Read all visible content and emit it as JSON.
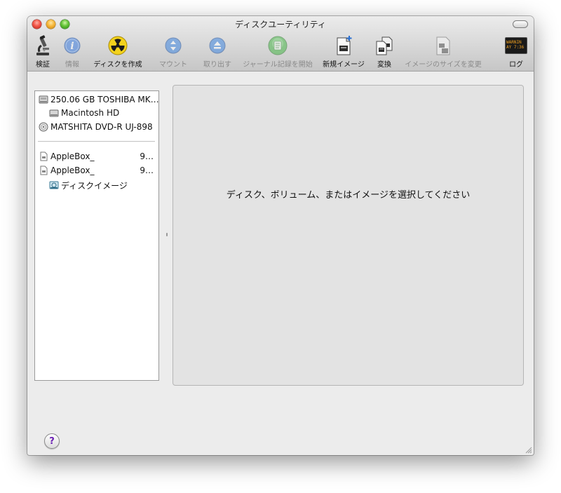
{
  "window": {
    "title": "ディスクユーティリティ"
  },
  "toolbar": {
    "items": [
      {
        "label": "検証",
        "icon": "microscope-icon",
        "enabled": true
      },
      {
        "label": "情報",
        "icon": "info-icon",
        "enabled": false
      },
      {
        "label": "ディスクを作成",
        "icon": "burn-icon",
        "enabled": true
      },
      {
        "label": "マウント",
        "icon": "mount-icon",
        "enabled": false
      },
      {
        "label": "取り出す",
        "icon": "eject-icon",
        "enabled": false
      },
      {
        "label": "ジャーナル記録を開始",
        "icon": "journal-icon",
        "enabled": false
      },
      {
        "label": "新規イメージ",
        "icon": "new-image-icon",
        "enabled": true
      },
      {
        "label": "変換",
        "icon": "convert-icon",
        "enabled": true
      },
      {
        "label": "イメージのサイズを変更",
        "icon": "resize-image-icon",
        "enabled": false
      },
      {
        "label": "ログ",
        "icon": "log-icon",
        "enabled": true,
        "screen_text": "WARNIN\nAY 7:36 P"
      }
    ]
  },
  "sidebar": {
    "devices": [
      {
        "label": "250.06 GB TOSHIBA MK…",
        "icon": "hard-disk-icon"
      },
      {
        "label": "Macintosh HD",
        "icon": "volume-icon"
      },
      {
        "label": "MATSHITA DVD-R UJ-898",
        "icon": "optical-drive-icon"
      }
    ],
    "images": [
      {
        "label": "AppleBox_",
        "suffix": "9…",
        "icon": "disk-image-file-icon"
      },
      {
        "label": "AppleBox_",
        "suffix": "9…",
        "icon": "disk-image-file-icon"
      },
      {
        "label": "ディスクイメージ",
        "icon": "mounted-image-icon"
      }
    ]
  },
  "main": {
    "placeholder": "ディスク、ボリューム、またはイメージを選択してください"
  },
  "help": {
    "label": "?"
  },
  "colors": {
    "help_glyph": "#6a1fb3",
    "burn_yellow": "#f3d21c",
    "info_blue": "#3c7de0"
  }
}
